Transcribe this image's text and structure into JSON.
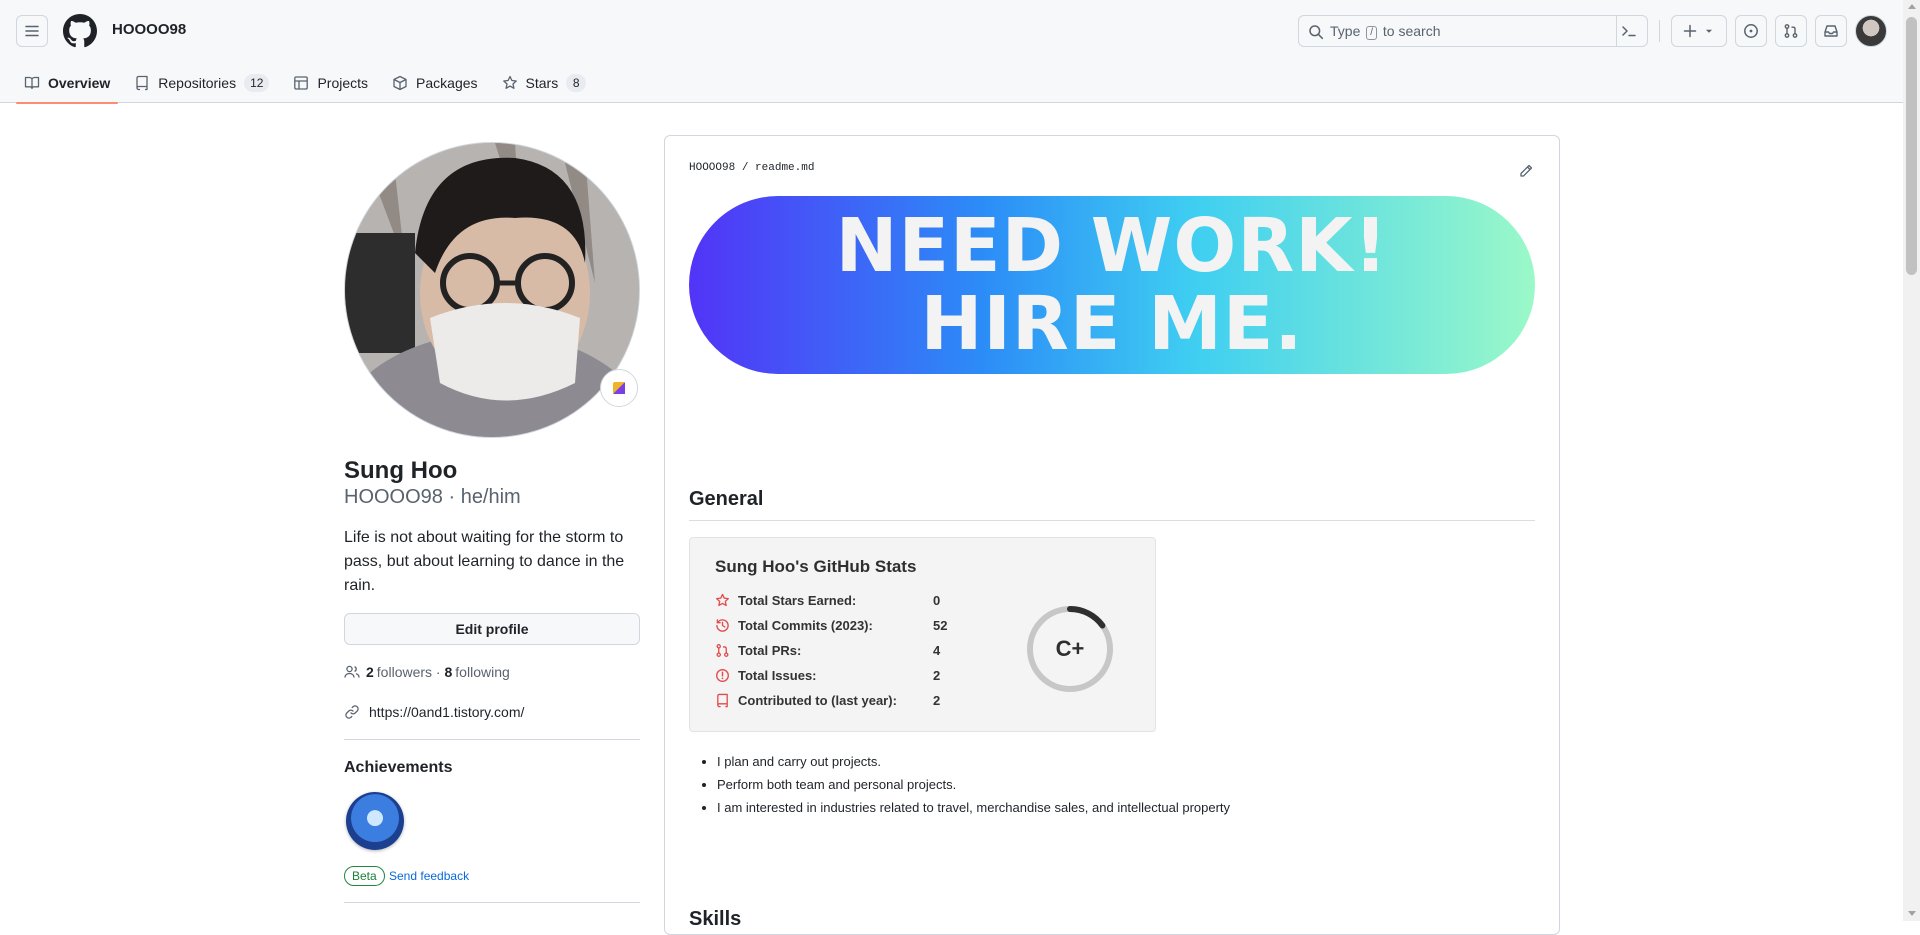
{
  "header": {
    "owner": "HOOOO98",
    "search_prefix": "Type",
    "search_slash": "/",
    "search_suffix": "to search"
  },
  "tabs": [
    {
      "label": "Overview",
      "icon": "book-icon",
      "active": true
    },
    {
      "label": "Repositories",
      "icon": "repo-icon",
      "count": "12"
    },
    {
      "label": "Projects",
      "icon": "table-icon"
    },
    {
      "label": "Packages",
      "icon": "package-icon"
    },
    {
      "label": "Stars",
      "icon": "star-icon",
      "count": "8"
    }
  ],
  "profile": {
    "name": "Sung Hoo",
    "handle": "HOOOO98 · he/him",
    "bio": "Life is not about waiting for the storm to pass, but about learning to dance in the rain.",
    "edit_label": "Edit profile",
    "followers_count": "2",
    "followers_label": "followers",
    "following_count": "8",
    "following_label": "following",
    "dot": " · ",
    "website": "https://0and1.tistory.com/",
    "achievements_title": "Achievements",
    "beta_label": "Beta",
    "feedback_label": "Send feedback"
  },
  "readme": {
    "path_owner": "HOOOO98",
    "path_sep": "/",
    "path_file": "readme.md",
    "banner_line1": "NEED WORK!",
    "banner_line2": "HIRE ME.",
    "general_heading": "General",
    "stats_title": "Sung Hoo's GitHub Stats",
    "stats": [
      {
        "label": "Total Stars Earned:",
        "value": "0",
        "icon": "star-icon"
      },
      {
        "label": "Total Commits (2023):",
        "value": "52",
        "icon": "history-icon"
      },
      {
        "label": "Total PRs:",
        "value": "4",
        "icon": "pull-request-icon"
      },
      {
        "label": "Total Issues:",
        "value": "2",
        "icon": "issue-icon"
      },
      {
        "label": "Contributed to (last year):",
        "value": "2",
        "icon": "repo-icon"
      }
    ],
    "rank": "C+",
    "rank_progress": 0.15,
    "bullets": [
      "I plan and carry out projects.",
      "Perform both team and personal projects.",
      "I am interested in industries related to travel, merchandise sales, and intellectual property"
    ],
    "skills_heading": "Skills"
  },
  "colors": {
    "accent_tab": "#fd8c73",
    "stat_icon": "#e24b4b",
    "link": "#0969da",
    "banner_start": "#5234f7",
    "banner_end": "#9bf9c8"
  }
}
